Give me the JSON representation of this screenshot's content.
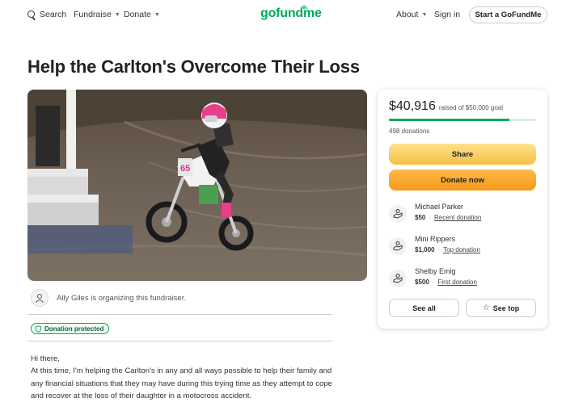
{
  "nav": {
    "search_label": "Search",
    "fundraise_label": "Fundraise",
    "donate_label": "Donate",
    "logo_text": "gofundme",
    "about_label": "About",
    "signin_label": "Sign in",
    "start_label": "Start a GoFundMe"
  },
  "campaign": {
    "title": "Help the Carlton's Overcome Their Loss",
    "organizer_text": "Ally Giles is organizing this fundraiser.",
    "badge_label": "Donation protected",
    "story": [
      "Hi there,",
      "At this time, I'm helping the Carlton's in any and all ways possible to help their family and any financial situations that they may have during this trying time as they attempt to cope and recover at the loss of their daughter in a motocross accident."
    ]
  },
  "donation_card": {
    "raised_amount": "$40,916",
    "goal_text": "raised of $50,000 goal",
    "progress_fraction": 0.818,
    "donations_count": "498 donations",
    "share_label": "Share",
    "donate_label": "Donate now",
    "donors": [
      {
        "name": "Michael Parker",
        "amount": "$50",
        "tag": "Recent donation"
      },
      {
        "name": "Mini Rippers",
        "amount": "$1,000",
        "tag": "Top donation"
      },
      {
        "name": "Shelby Emig",
        "amount": "$500",
        "tag": "First donation"
      }
    ],
    "see_all_label": "See all",
    "see_top_label": "See top"
  },
  "colors": {
    "brand_green": "#02a95c",
    "share_yellow": "#f5c04a",
    "donate_orange": "#f59a1a"
  }
}
